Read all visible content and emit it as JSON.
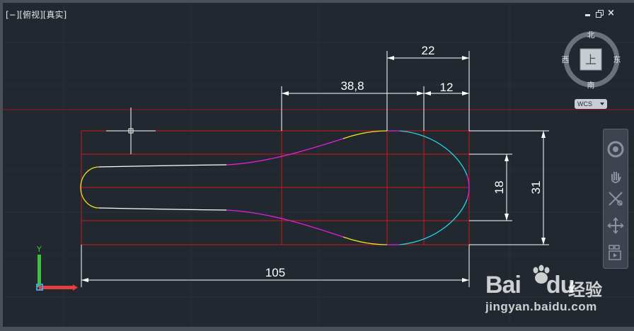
{
  "viewport": {
    "label": "[−][俯视][真实]",
    "window_controls": {
      "minimize_icon": "minimize-icon",
      "restore_icon": "restore-icon",
      "close_label": "×"
    }
  },
  "viewcube": {
    "north": "北",
    "south": "南",
    "east": "东",
    "west": "西",
    "face": "上"
  },
  "wcs": {
    "label": "WCS"
  },
  "dimensions": {
    "overall_length": "105",
    "bowl_width": "22",
    "handle_offset": "38,8",
    "bowl_tip": "12",
    "inner_height": "18",
    "outer_height": "31"
  },
  "colors": {
    "background": "#212830",
    "construction_lines": "#d01818",
    "dimension_lines": "#ffffff",
    "curve_white": "#ffffff",
    "curve_magenta": "#e020e0",
    "curve_yellow": "#f0e020",
    "curve_cyan": "#20d8e8",
    "ucs_x": "#e04040",
    "ucs_y": "#40c040"
  },
  "navbar": {
    "items": [
      "steering-wheel-icon",
      "pan-hand-icon",
      "zoom-extents-icon",
      "orbit-icon",
      "showmotion-icon"
    ]
  },
  "watermark": {
    "brand_left": "Bai",
    "brand_mid": "du",
    "brand_right": "经验",
    "url": "jingyan.baidu.com"
  },
  "ucs": {
    "x_axis": "X",
    "y_axis": "Y"
  }
}
